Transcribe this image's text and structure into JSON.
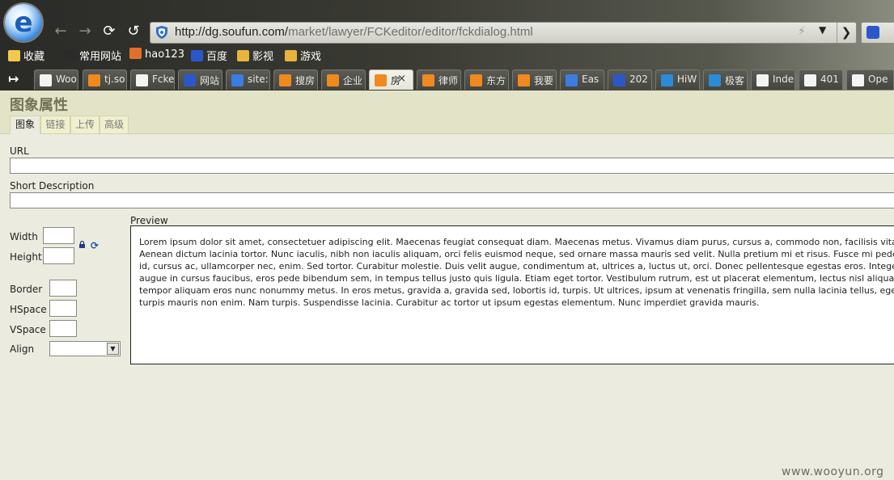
{
  "browser": {
    "logo_letter": "e",
    "url": {
      "host": "http://dg.soufun.com/",
      "path": "market/lawyer/FCKeditor/editor/fckdialog.html"
    }
  },
  "favorites": [
    {
      "label": "收藏",
      "icon": "star-icon",
      "color": "#f2c94c"
    },
    {
      "label": "常用网站",
      "icon": "grid-icon",
      "color": "#2b2b2b"
    },
    {
      "label": "hao123",
      "icon": "hao123-icon",
      "color": "#e0702a"
    },
    {
      "label": "百度",
      "icon": "baidu-paw-icon",
      "color": "#2b57c9"
    },
    {
      "label": "影视",
      "icon": "folder-icon",
      "color": "#e7b43c"
    },
    {
      "label": "游戏",
      "icon": "folder-icon",
      "color": "#e7b43c"
    }
  ],
  "tabs": [
    {
      "label": "Woo",
      "icon": "page-icon",
      "color": "#f4f4f4"
    },
    {
      "label": "tj.so",
      "icon": "fang-icon",
      "color": "#f08a1e"
    },
    {
      "label": "Fcke",
      "icon": "page-icon",
      "color": "#f4f4f4"
    },
    {
      "label": "网站",
      "icon": "baidu-paw-icon",
      "color": "#2b57c9"
    },
    {
      "label": "site:",
      "icon": "google-icon",
      "color": "#3b7de0"
    },
    {
      "label": "搜房",
      "icon": "fang-icon",
      "color": "#f08a1e"
    },
    {
      "label": "企业",
      "icon": "fang-icon",
      "color": "#f08a1e"
    },
    {
      "label": "房",
      "icon": "fang-icon",
      "color": "#f08a1e",
      "active": true,
      "close": "×"
    },
    {
      "label": "律师",
      "icon": "fang-icon",
      "color": "#f08a1e"
    },
    {
      "label": "东方",
      "icon": "fang-icon",
      "color": "#f08a1e"
    },
    {
      "label": "我要",
      "icon": "fang-icon",
      "color": "#f08a1e"
    },
    {
      "label": "Eas",
      "icon": "google-icon",
      "color": "#3b7de0"
    },
    {
      "label": "202",
      "icon": "baidu-paw-icon",
      "color": "#2b57c9"
    },
    {
      "label": "HiW",
      "icon": "hi-icon",
      "color": "#2a8bd6"
    },
    {
      "label": "极客",
      "icon": "hi-icon",
      "color": "#2a8bd6"
    },
    {
      "label": "Inde",
      "icon": "page-icon",
      "color": "#f4f4f4"
    },
    {
      "label": "401",
      "icon": "page-icon",
      "color": "#f4f4f4"
    },
    {
      "label": "Ope",
      "icon": "page-icon",
      "color": "#f4f4f4"
    }
  ],
  "dialog": {
    "title": "图象属性",
    "tabs": [
      "图象",
      "链接",
      "上传",
      "高级"
    ],
    "url_label": "URL",
    "url_value": "",
    "short_desc_label": "Short Description",
    "short_desc_value": "",
    "width_label": "Width",
    "height_label": "Height",
    "border_label": "Border",
    "hspace_label": "HSpace",
    "vspace_label": "VSpace",
    "align_label": "Align",
    "align_value": "",
    "preview_label": "Preview",
    "preview_text": "Lorem ipsum dolor sit amet, consectetuer adipiscing elit. Maecenas feugiat consequat diam. Maecenas metus. Vivamus diam purus, cursus a, commodo non, facilisis vitae, nulla. Aenean dictum lacinia tortor. Nunc iaculis, nibh non iaculis aliquam, orci felis euismod neque, sed ornare massa mauris sed velit. Nulla pretium mi et risus. Fusce mi pede, tempor id, cursus ac, ullamcorper nec, enim. Sed tortor. Curabitur molestie. Duis velit augue, condimentum at, ultrices a, luctus ut, orci. Donec pellentesque egestas eros. Integer cursus, augue in cursus faucibus, eros pede bibendum sem, in tempus tellus justo quis ligula. Etiam eget tortor. Vestibulum rutrum, est ut placerat elementum, lectus nisl aliquam velit, tempor aliquam eros nunc nonummy metus. In eros metus, gravida a, gravida sed, lobortis id, turpis. Ut ultrices, ipsum at venenatis fringilla, sem nulla lacinia tellus, eget aliquet turpis mauris non enim. Nam turpis. Suspendisse lacinia. Curabitur ac tortor ut ipsum egestas elementum. Nunc imperdiet gravida mauris."
  },
  "watermark": "www.wooyun.org"
}
